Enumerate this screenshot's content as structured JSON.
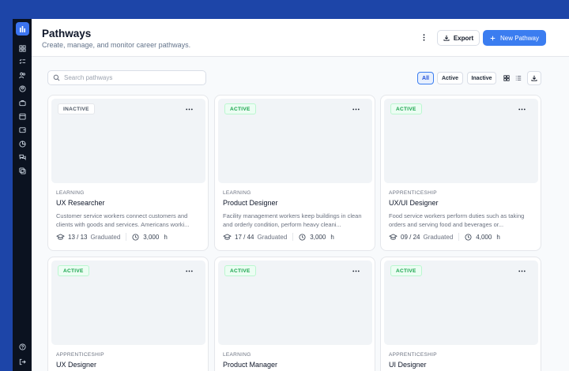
{
  "header": {
    "title": "Pathways",
    "subtitle": "Create, manage, and monitor career pathways.",
    "export_label": "Export",
    "new_label": "New Pathway"
  },
  "search": {
    "placeholder": "Search pathways"
  },
  "filters": {
    "all": "All",
    "active": "Active",
    "inactive": "Inactive"
  },
  "cards": [
    {
      "status": "INACTIVE",
      "type": "LEARNING",
      "name": "UX Researcher",
      "desc": "Customer service workers connect customers and clients with goods and services. Americans worki...",
      "progress": "13 / 13",
      "graduated": "Graduated",
      "hours": "3,000",
      "unit": "h"
    },
    {
      "status": "ACTIVE",
      "type": "LEARNING",
      "name": "Product Designer",
      "desc": "Facility management workers keep buildings in clean and orderly condition, perform heavy cleani...",
      "progress": "17 / 44",
      "graduated": "Graduated",
      "hours": "3,000",
      "unit": "h"
    },
    {
      "status": "ACTIVE",
      "type": "APPRENTICESHIP",
      "name": "UX/UI Designer",
      "desc": "Food service workers perform duties such as taking orders and serving food and beverages or...",
      "progress": "09 / 24",
      "graduated": "Graduated",
      "hours": "4,000",
      "unit": "h"
    },
    {
      "status": "ACTIVE",
      "type": "APPRENTICESHIP",
      "name": "UX Designer"
    },
    {
      "status": "ACTIVE",
      "type": "LEARNING",
      "name": "Product Manager"
    },
    {
      "status": "ACTIVE",
      "type": "APPRENTICESHIP",
      "name": "UI Designer"
    }
  ],
  "colors": {
    "accent": "#3b7df0",
    "rail": "#0b1220",
    "frame": "#1d45a8",
    "active_green": "#16a34a"
  }
}
